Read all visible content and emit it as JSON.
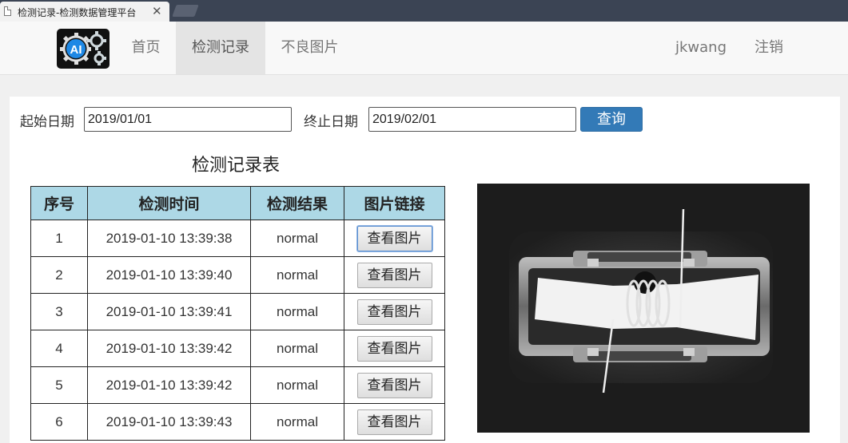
{
  "browser": {
    "tab_title": "检测记录-检测数据管理平台",
    "close_glyph": "✕"
  },
  "nav": {
    "logo_text": "AI",
    "items": [
      {
        "label": "首页",
        "active": false
      },
      {
        "label": "检测记录",
        "active": true
      },
      {
        "label": "不良图片",
        "active": false
      }
    ],
    "user": "jkwang",
    "logout": "注销"
  },
  "filter": {
    "start_label": "起始日期",
    "start_value": "2019/01/01",
    "end_label": "终止日期",
    "end_value": "2019/02/01",
    "query_label": "查询"
  },
  "table": {
    "title": "检测记录表",
    "headers": [
      "序号",
      "检测时间",
      "检测结果",
      "图片链接"
    ],
    "rows": [
      {
        "no": "1",
        "time": "2019-01-10 13:39:38",
        "result": "normal",
        "link": "查看图片"
      },
      {
        "no": "2",
        "time": "2019-01-10 13:39:40",
        "result": "normal",
        "link": "查看图片"
      },
      {
        "no": "3",
        "time": "2019-01-10 13:39:41",
        "result": "normal",
        "link": "查看图片"
      },
      {
        "no": "4",
        "time": "2019-01-10 13:39:42",
        "result": "normal",
        "link": "查看图片"
      },
      {
        "no": "5",
        "time": "2019-01-10 13:39:42",
        "result": "normal",
        "link": "查看图片"
      },
      {
        "no": "6",
        "time": "2019-01-10 13:39:43",
        "result": "normal",
        "link": "查看图片"
      }
    ]
  },
  "colors": {
    "accent": "#337ab7",
    "header_bg": "#add8e6",
    "tabstrip": "#3b4454"
  }
}
